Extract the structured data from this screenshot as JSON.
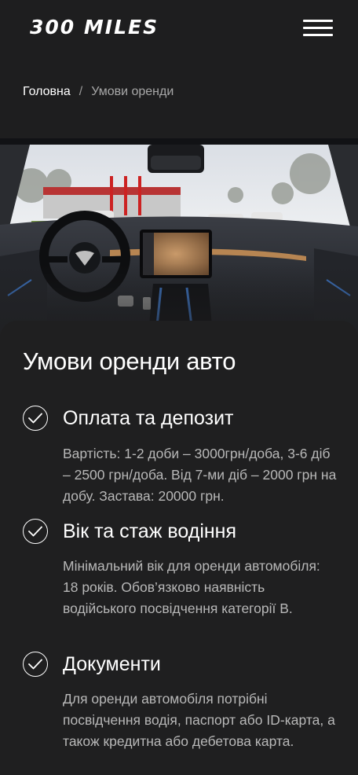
{
  "header": {
    "logo": "300 MILES",
    "menu_icon": "hamburger-menu-icon"
  },
  "breadcrumb": {
    "home": "Головна",
    "separator": "/",
    "current": "Умови оренди"
  },
  "hero": {
    "image_subject": "car interior dashboard"
  },
  "terms": {
    "title": "Умови оренди авто",
    "items": [
      {
        "title": "Оплата та депозит",
        "text": "Вартість: 1-2 доби – 3000грн/доба, 3-6 діб – 2500 грн/доба. Від 7-ми діб – 2000 грн на добу. Застава: 20000 грн.",
        "icon": "check-circle-icon"
      },
      {
        "title": "Вік та стаж водіння",
        "text": "Мінімальний вік для оренди автомобіля: 18 років. Обов’язково наявність водійського посвідчення категорії В.",
        "icon": "check-circle-icon"
      },
      {
        "title": "Документи",
        "text": "Для оренди автомобіля потрібні посвідчення водія, паспорт або ID-карта, а також кредитна або дебетова карта.",
        "icon": "check-circle-icon"
      }
    ]
  },
  "colors": {
    "background": "#1e1e1f",
    "text": "#ffffff",
    "muted_text": "#b8b8b8"
  }
}
